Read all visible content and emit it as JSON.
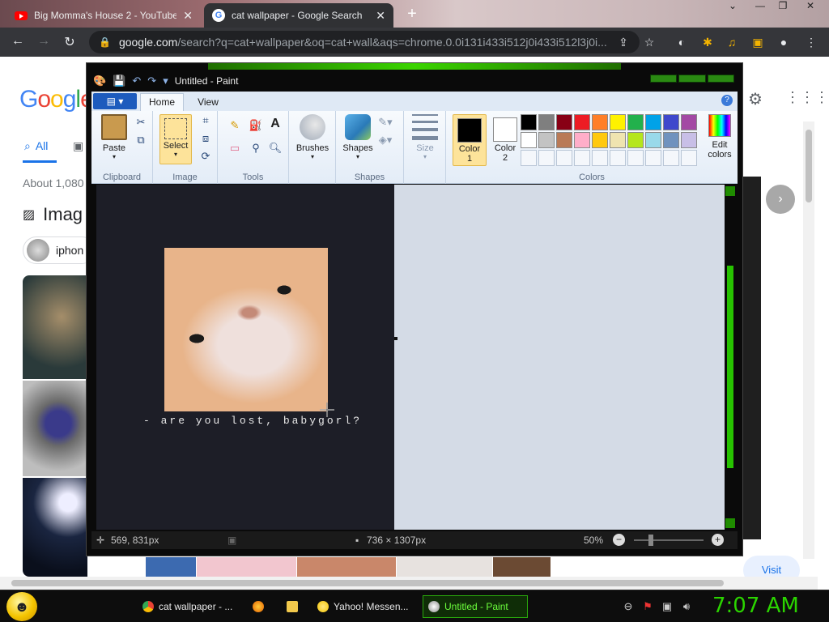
{
  "browser": {
    "tabs": [
      {
        "title": "Big Momma's House 2 - YouTube",
        "icon": "youtube-icon"
      },
      {
        "title": "cat wallpaper - Google Search",
        "icon": "google-icon",
        "active": true
      }
    ],
    "address": {
      "domain": "google.com",
      "path": "/search?q=cat+wallpaper&oq=cat+wall&aqs=chrome.0.0i131i433i512j0i433i512l3j0i..."
    }
  },
  "google": {
    "logo_text": "Google",
    "tab_all": "All",
    "results_prefix": "About 1,080",
    "images_heading": "Imag",
    "chip_label": "iphon",
    "visit": "Visit"
  },
  "paint": {
    "title": "Untitled - Paint",
    "tabs": {
      "home": "Home",
      "view": "View"
    },
    "groups": {
      "clipboard": "Clipboard",
      "image": "Image",
      "tools": "Tools",
      "shapes": "Shapes",
      "colors": "Colors"
    },
    "buttons": {
      "paste": "Paste",
      "select": "Select",
      "brushes": "Brushes",
      "shapes": "Shapes",
      "size": "Size",
      "color1": "Color\n1",
      "color2": "Color\n2",
      "edit_colors": "Edit\ncolors"
    },
    "color1": "#000000",
    "color2": "#ffffff",
    "palette_row1": [
      "#000000",
      "#7f7f7f",
      "#880015",
      "#ed1c24",
      "#ff7f27",
      "#fff200",
      "#22b14c",
      "#00a2e8",
      "#3f48cc",
      "#a349a4"
    ],
    "palette_row2": [
      "#ffffff",
      "#c3c3c3",
      "#b97a57",
      "#ffaec9",
      "#ffc90e",
      "#efe4b0",
      "#b5e61d",
      "#99d9ea",
      "#7092be",
      "#c8bfe7"
    ],
    "canvas_caption": "- are you lost, babygorl?",
    "status": {
      "cursor_pos": "569, 831px",
      "image_size": "736 × 1307px",
      "zoom": "50%"
    }
  },
  "taskbar": {
    "items": [
      {
        "label": "cat wallpaper - ...",
        "icon": "chrome-icon"
      },
      {
        "label": "",
        "icon": "firefox-icon"
      },
      {
        "label": "",
        "icon": "folder-icon"
      },
      {
        "label": "Yahoo! Messen...",
        "icon": "yahoo-messenger-icon"
      },
      {
        "label": "Untitled - Paint",
        "icon": "paint-icon",
        "active": true
      }
    ],
    "clock": "7:07 AM"
  }
}
